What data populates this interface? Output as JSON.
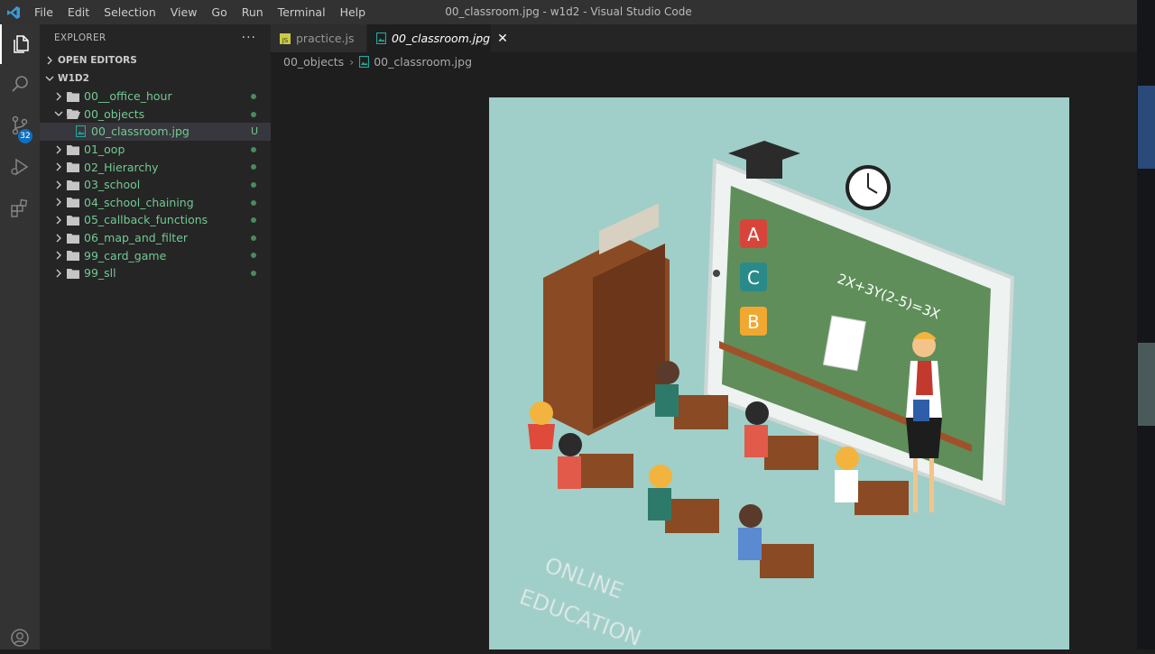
{
  "window": {
    "title": "00_classroom.jpg - w1d2 - Visual Studio Code",
    "menu": [
      "File",
      "Edit",
      "Selection",
      "View",
      "Go",
      "Run",
      "Terminal",
      "Help"
    ]
  },
  "activity_bar": {
    "source_control_badge": "32"
  },
  "explorer": {
    "header": "EXPLORER",
    "open_editors": "OPEN EDITORS",
    "workspace": "W1D2",
    "items": [
      {
        "label": "00__office_hour",
        "status": "dot"
      },
      {
        "label": "00_objects",
        "status": "dot"
      },
      {
        "label": "00_classroom.jpg",
        "status": "U"
      },
      {
        "label": "01_oop",
        "status": "dot"
      },
      {
        "label": "02_Hierarchy",
        "status": "dot"
      },
      {
        "label": "03_school",
        "status": "dot"
      },
      {
        "label": "04_school_chaining",
        "status": "dot"
      },
      {
        "label": "05_callback_functions",
        "status": "dot"
      },
      {
        "label": "06_map_and_filter",
        "status": "dot"
      },
      {
        "label": "99_card_game",
        "status": "dot"
      },
      {
        "label": "99_sll",
        "status": "dot"
      }
    ]
  },
  "tabs": [
    {
      "label": "practice.js",
      "active": false
    },
    {
      "label": "00_classroom.jpg",
      "active": true
    }
  ],
  "breadcrumb": [
    "00_objects",
    "00_classroom.jpg"
  ],
  "image": {
    "board_formula": "2X+3Y(2-5)=3X",
    "card_letters": [
      "A",
      "C",
      "B"
    ],
    "caption_line1": "ONLINE",
    "caption_line2": "EDUCATION"
  },
  "colors": {
    "accent": "#0e70c0",
    "git_untracked": "#73c991",
    "image_bg": "#9fcfc8"
  }
}
